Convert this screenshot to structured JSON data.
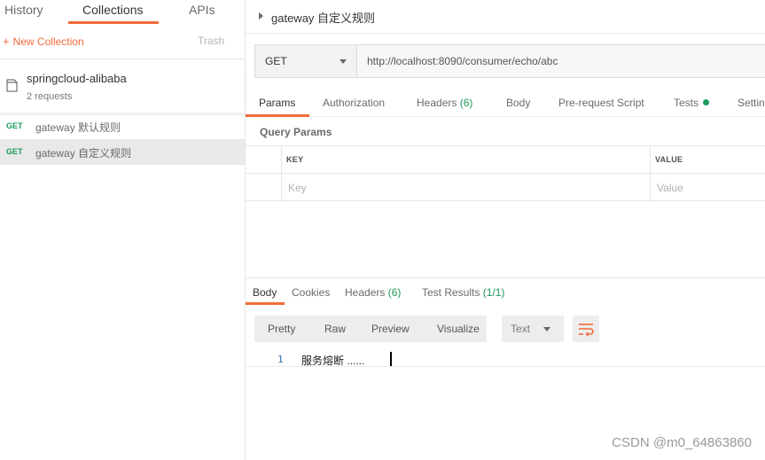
{
  "sidebar": {
    "tabs": [
      "History",
      "Collections",
      "APIs"
    ],
    "new_collection": "New Collection",
    "trash": "Trash",
    "collection": {
      "name": "springcloud-alibaba",
      "count": "2 requests"
    },
    "requests": [
      {
        "method": "GET",
        "name": "gateway 默认规则"
      },
      {
        "method": "GET",
        "name": "gateway 自定义规则",
        "selected": true
      }
    ]
  },
  "main": {
    "title": "gateway 自定义规则",
    "method": "GET",
    "url": "http://localhost:8090/consumer/echo/abc",
    "tabs": [
      {
        "label": "Params"
      },
      {
        "label": "Authorization"
      },
      {
        "label": "Headers",
        "count": "(6)"
      },
      {
        "label": "Body"
      },
      {
        "label": "Pre-request Script"
      },
      {
        "label": "Tests"
      },
      {
        "label": "Settin"
      }
    ],
    "query_params_label": "Query Params",
    "table": {
      "key_header": "KEY",
      "value_header": "VALUE",
      "key_placeholder": "Key",
      "value_placeholder": "Value"
    }
  },
  "response": {
    "tabs": [
      {
        "label": "Body"
      },
      {
        "label": "Cookies"
      },
      {
        "label": "Headers",
        "count": "(6)"
      },
      {
        "label": "Test Results",
        "count": "(1/1)"
      }
    ],
    "view_buttons": [
      "Pretty",
      "Raw",
      "Preview",
      "Visualize"
    ],
    "format": "Text",
    "line_number": "1",
    "line_text": "服务熔断 ......"
  },
  "colors": {
    "accent": "#f26b3a",
    "success": "#1c9a5b"
  },
  "watermark": "CSDN @m0_64863860"
}
